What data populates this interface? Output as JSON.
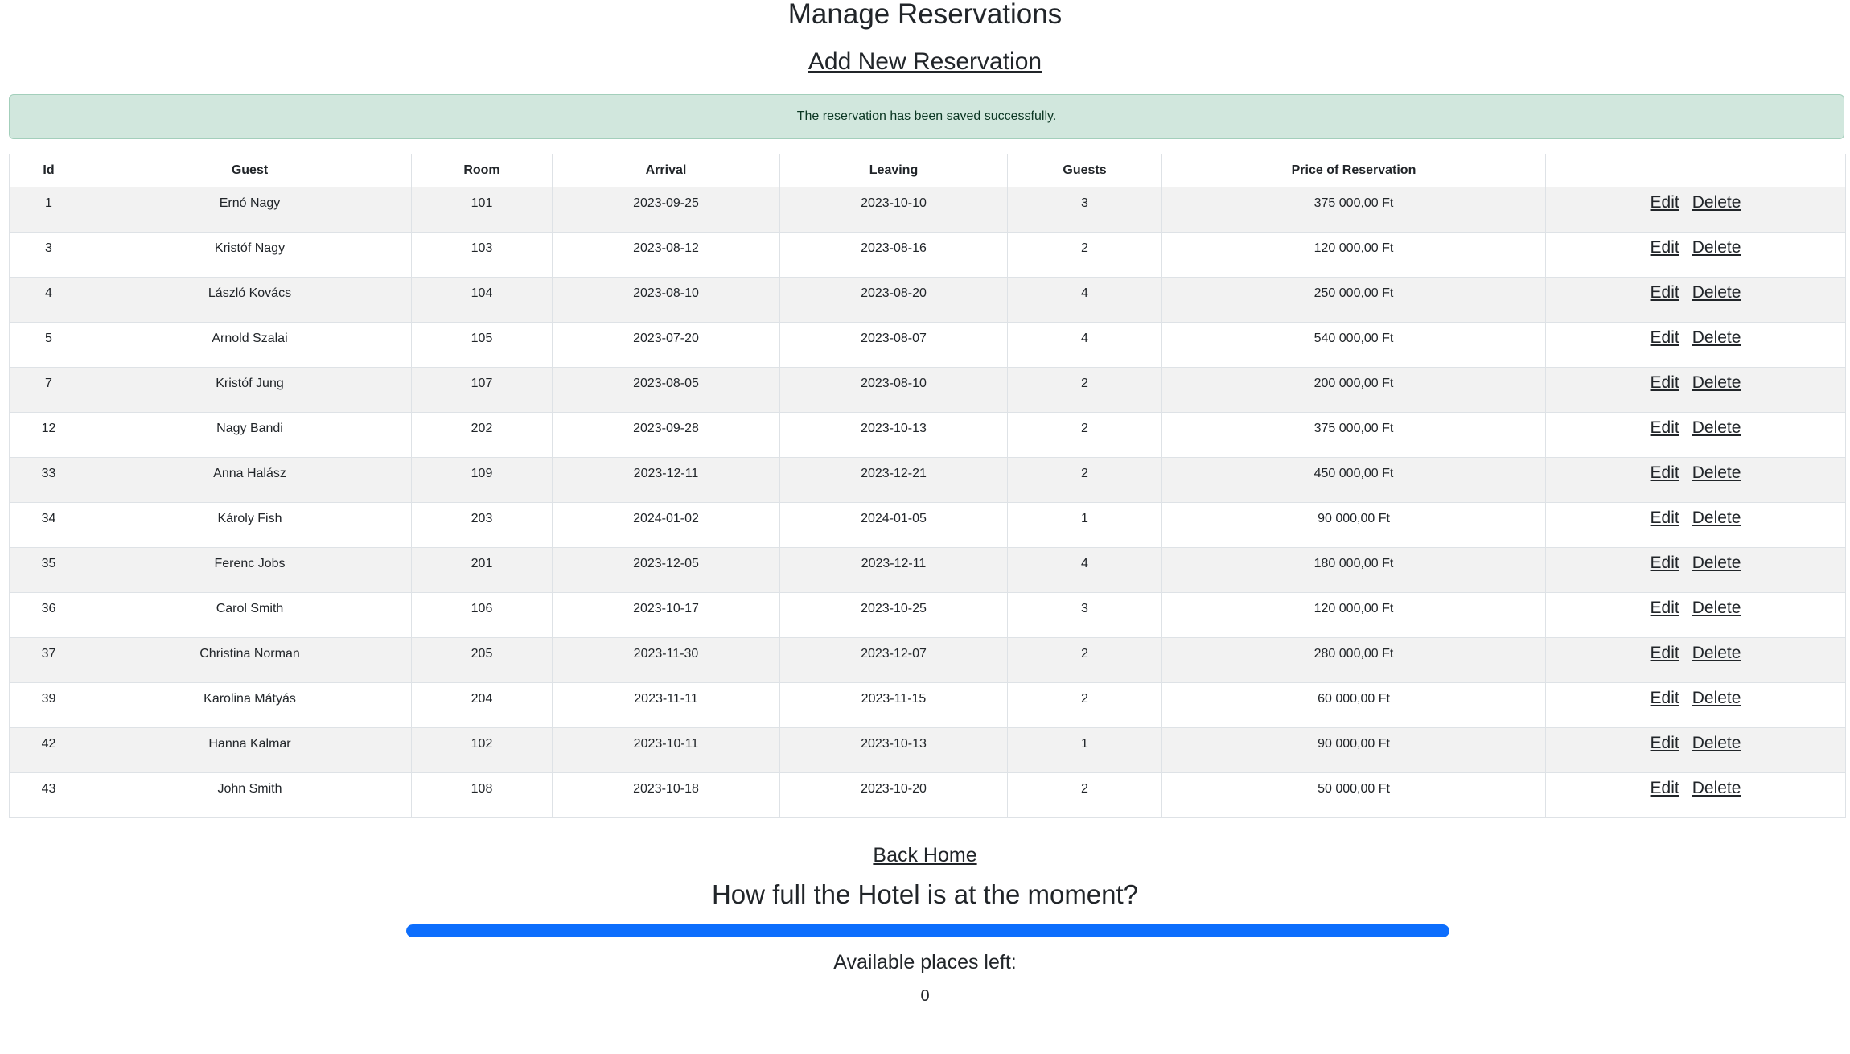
{
  "page": {
    "title": "Manage Reservations",
    "add_link": "Add New Reservation",
    "alert": "The reservation has been saved successfully.",
    "back_link": "Back Home",
    "fill_heading": "How full the Hotel is at the moment?",
    "fill_percent": 100,
    "available_label": "Available places left:",
    "available_value": "0"
  },
  "table": {
    "headers": [
      "Id",
      "Guest",
      "Room",
      "Arrival",
      "Leaving",
      "Guests",
      "Price of Reservation",
      ""
    ],
    "edit_label": "Edit",
    "delete_label": "Delete",
    "rows": [
      [
        "1",
        "Ernó Nagy",
        "101",
        "2023-09-25",
        "2023-10-10",
        "3",
        "375 000,00 Ft"
      ],
      [
        "3",
        "Kristóf Nagy",
        "103",
        "2023-08-12",
        "2023-08-16",
        "2",
        "120 000,00 Ft"
      ],
      [
        "4",
        "László Kovács",
        "104",
        "2023-08-10",
        "2023-08-20",
        "4",
        "250 000,00 Ft"
      ],
      [
        "5",
        "Arnold Szalai",
        "105",
        "2023-07-20",
        "2023-08-07",
        "4",
        "540 000,00 Ft"
      ],
      [
        "7",
        "Kristóf Jung",
        "107",
        "2023-08-05",
        "2023-08-10",
        "2",
        "200 000,00 Ft"
      ],
      [
        "12",
        "Nagy Bandi",
        "202",
        "2023-09-28",
        "2023-10-13",
        "2",
        "375 000,00 Ft"
      ],
      [
        "33",
        "Anna Halász",
        "109",
        "2023-12-11",
        "2023-12-21",
        "2",
        "450 000,00 Ft"
      ],
      [
        "34",
        "Károly Fish",
        "203",
        "2024-01-02",
        "2024-01-05",
        "1",
        "90 000,00 Ft"
      ],
      [
        "35",
        "Ferenc Jobs",
        "201",
        "2023-12-05",
        "2023-12-11",
        "4",
        "180 000,00 Ft"
      ],
      [
        "36",
        "Carol Smith",
        "106",
        "2023-10-17",
        "2023-10-25",
        "3",
        "120 000,00 Ft"
      ],
      [
        "37",
        "Christina Norman",
        "205",
        "2023-11-30",
        "2023-12-07",
        "2",
        "280 000,00 Ft"
      ],
      [
        "39",
        "Karolina Mátyás",
        "204",
        "2023-11-11",
        "2023-11-15",
        "2",
        "60 000,00 Ft"
      ],
      [
        "42",
        "Hanna Kalmar",
        "102",
        "2023-10-11",
        "2023-10-13",
        "1",
        "90 000,00 Ft"
      ],
      [
        "43",
        "John Smith",
        "108",
        "2023-10-18",
        "2023-10-20",
        "2",
        "50 000,00 Ft"
      ]
    ]
  }
}
